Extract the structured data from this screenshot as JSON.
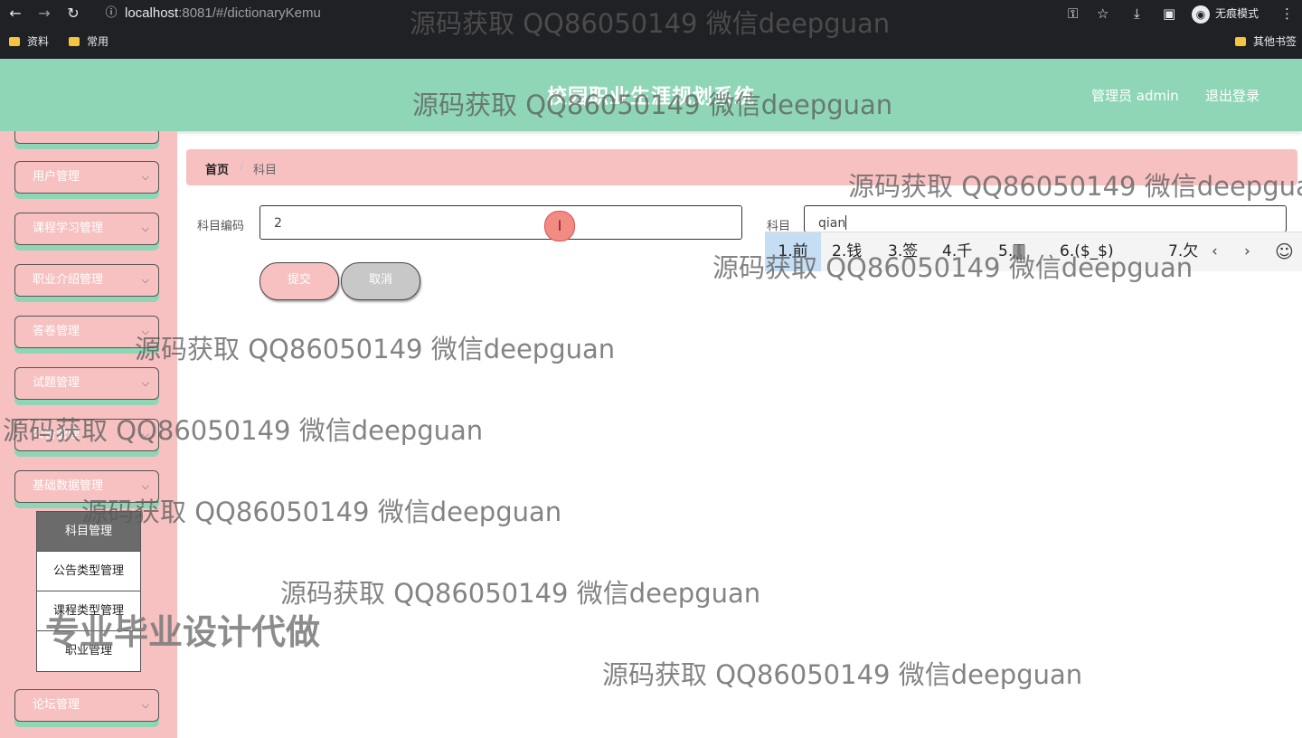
{
  "browser": {
    "url_host": "localhost",
    "url_path": ":8081/#/dictionaryKemu",
    "incognito_label": "无痕模式",
    "bookmarks": [
      "资料",
      "常用"
    ],
    "other_bookmarks": "其他书签"
  },
  "header": {
    "title": "校园职业生涯规划系统",
    "admin": "管理员 admin",
    "logout": "退出登录"
  },
  "sidebar": {
    "items": [
      {
        "label": "用户管理"
      },
      {
        "label": "课程学习管理"
      },
      {
        "label": "职业介绍管理"
      },
      {
        "label": "答卷管理"
      },
      {
        "label": "试题管理"
      },
      {
        "label": "公告管理"
      },
      {
        "label": "基础数据管理"
      },
      {
        "label": "论坛管理"
      }
    ],
    "submenu": [
      {
        "label": "科目管理"
      },
      {
        "label": "公告类型管理"
      },
      {
        "label": "课程类型管理"
      },
      {
        "label": "职业管理"
      }
    ]
  },
  "breadcrumb": {
    "home": "首页",
    "separator": "/",
    "current": "科目"
  },
  "form": {
    "code_label": "科目编码",
    "code_value": "2",
    "name_label": "科目",
    "name_value": "qian",
    "submit": "提交",
    "cancel": "取消"
  },
  "ime": {
    "candidates": [
      "1.前",
      "2.钱",
      "3.签",
      "4.千",
      "5.🀫",
      "6.($_$)",
      "7.欠"
    ],
    "prev": "‹",
    "next": "›",
    "emoji": "☺"
  },
  "watermarks": {
    "text": "源码获取 QQ86050149 微信deepguan",
    "promo": "专业毕业设计代做"
  },
  "colors": {
    "header_green": "#8fd6b6",
    "sidebar_pink": "#f7c1c1",
    "active_submenu": "#6b6b6b"
  }
}
